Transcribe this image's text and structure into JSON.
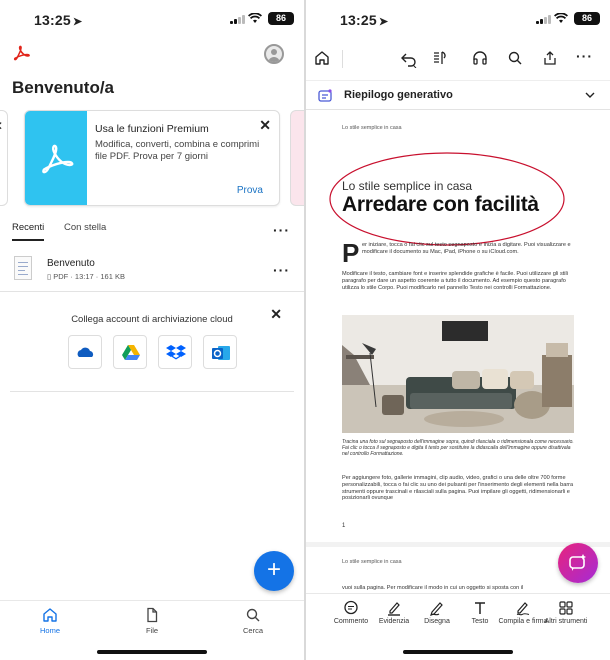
{
  "left": {
    "status": {
      "time": "13:25",
      "battery": "86"
    },
    "welcome": "Benvenuto/a",
    "promo": {
      "title": "Usa le funzioni Premium",
      "description": "Modifica, converti, combina e comprimi file PDF. Prova per 7 giorni",
      "cta": "Prova"
    },
    "tabs": [
      "Recenti",
      "Con stella"
    ],
    "file": {
      "name": "Benvenuto",
      "type": "PDF",
      "time": "13:17",
      "size": "161 KB"
    },
    "cloud": {
      "title": "Collega account di archiviazione cloud",
      "services": [
        "onedrive-icon",
        "google-drive-icon",
        "dropbox-icon",
        "outlook-icon"
      ]
    },
    "nav": [
      "Home",
      "File",
      "Cerca"
    ]
  },
  "right": {
    "status": {
      "time": "13:25",
      "battery": "86"
    },
    "summary_label": "Riepilogo generativo",
    "document": {
      "running_header": "Lo stile semplice in casa",
      "kicker": "Lo stile semplice in casa",
      "headline": "Arredare con facilità",
      "dropcap": "P",
      "para1": "er iniziare, tocca o fai clic sul testo segnaposto e inizia a digitare. Puoi visualizzare e modificare il documento su Mac, iPad, iPhone o su iCloud.com.",
      "para2": "Modificare il testo, cambiare font e inserire splendide grafiche è facile. Puoi utilizzare gli stili paragrafo per dare un aspetto coerente a tutto il documento. Ad esempio questo paragrafo utilizza lo stile Corpo. Puoi modificarlo nel pannello Testo nei controlli Formattazione.",
      "caption": "Tracina una foto sul segnaposto dell'immagine sopra, quindi rilasciala o ridimensionala come necessario. Fai clic o tocca il segnaposto e digita il testo per sostituire la didascalia dell'immagine oppure disattivala nel controllo Formattazione.",
      "para3": "Per aggiungere foto, gallerie immagini, clip audio, video, grafici o una delle oltre 700 forme personalizzabili, tocca o fai clic su uno dei pulsanti per l'inserimento degli elementi nella barra strumenti oppure trascinali e rilasciali sulla pagina. Puoi impilare gli oggetti, ridimensionarli e posizionarli ovunque",
      "page_number": "1",
      "page2_header": "Lo stile semplice in casa",
      "page2_text": "vuoi sulla pagina. Per modificare il modo in cui un oggetto si sposta con il"
    },
    "tools": [
      {
        "icon": "comment-icon",
        "label": "Commento"
      },
      {
        "icon": "highlight-icon",
        "label": "Evidenzia"
      },
      {
        "icon": "draw-icon",
        "label": "Disegna"
      },
      {
        "icon": "text-icon",
        "label": "Testo"
      },
      {
        "icon": "fill-sign-icon",
        "label": "Compila e firma"
      },
      {
        "icon": "more-tools-icon",
        "label": "Altri strumenti"
      }
    ]
  },
  "colors": {
    "adobe_red": "#e1251b",
    "accent_blue": "#1473e6",
    "promo_cyan": "#2fc3f0",
    "ellipse_red": "#c8102e"
  }
}
